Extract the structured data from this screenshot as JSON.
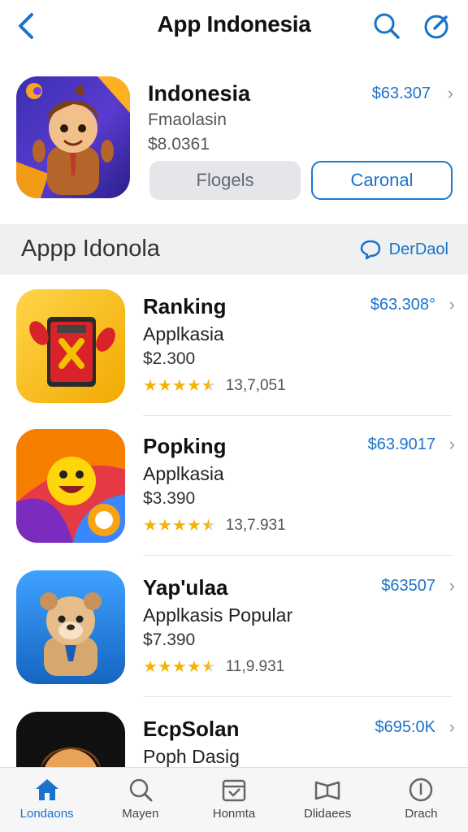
{
  "header": {
    "title": "App Indonesia"
  },
  "featured": {
    "name": "Indonesia",
    "subtitle": "Fmaolasin",
    "price": "$8.0361",
    "rank": "$63.307",
    "button_primary": "Flogels",
    "button_secondary": "Caronal"
  },
  "section": {
    "title": "Appp Idonola",
    "link": "DerDaol"
  },
  "apps": [
    {
      "name": "Ranking",
      "subtitle": "Applkasia",
      "price": "$2.300",
      "rank": "$63.308°",
      "rating": 4.5,
      "count": "13,7,051"
    },
    {
      "name": "Popking",
      "subtitle": "Applkasia",
      "price": "$3.390",
      "rank": "$63.9017",
      "rating": 4.5,
      "count": "13,7.931"
    },
    {
      "name": "Yap'ulaa",
      "subtitle": "Applkasis Popular",
      "price": "$7.390",
      "rating": 4.5,
      "rank": "$63507",
      "count": "11,9.931"
    },
    {
      "name": "EcpSolan",
      "subtitle": "Poph Dasig",
      "price": "",
      "rank": "$695:0K",
      "rating": 0,
      "count": ""
    }
  ],
  "tabs": [
    {
      "label": "Londaons",
      "icon": "home-icon",
      "active": true
    },
    {
      "label": "Mayen",
      "icon": "search-icon",
      "active": false
    },
    {
      "label": "Honmta",
      "icon": "calendar-icon",
      "active": false
    },
    {
      "label": "Dlidaees",
      "icon": "book-icon",
      "active": false
    },
    {
      "label": "Drach",
      "icon": "info-icon",
      "active": false
    }
  ],
  "colors": {
    "accent": "#1a73c9",
    "star": "#f5b301",
    "star_empty": "#cfd1d4"
  }
}
